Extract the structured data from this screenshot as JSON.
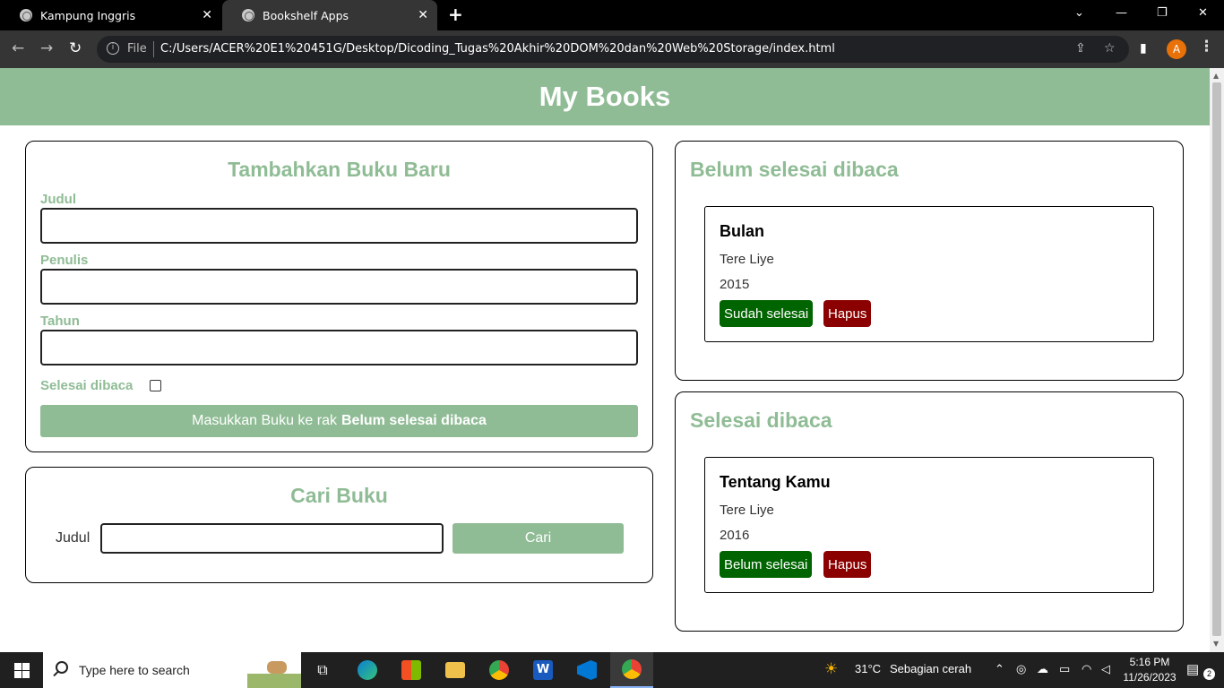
{
  "browser": {
    "tabs": [
      {
        "title": "Kampung Inggris",
        "active": false
      },
      {
        "title": "Bookshelf Apps",
        "active": true
      }
    ],
    "omnibox": {
      "scheme_label": "File",
      "url": "C:/Users/ACER%20E1%20451G/Desktop/Dicoding_Tugas%20Akhir%20DOM%20dan%20Web%20Storage/index.html"
    },
    "profile_initial": "A"
  },
  "page": {
    "header_title": "My Books",
    "add_form": {
      "title": "Tambahkan Buku Baru",
      "title_label": "Judul",
      "title_value": "",
      "author_label": "Penulis",
      "author_value": "",
      "year_label": "Tahun",
      "year_value": "",
      "complete_label": "Selesai dibaca",
      "complete_checked": false,
      "submit_prefix": "Masukkan Buku ke rak",
      "submit_target": "Belum selesai dibaca"
    },
    "search": {
      "title": "Cari Buku",
      "label": "Judul",
      "value": "",
      "button": "Cari"
    },
    "shelves": [
      {
        "title": "Belum selesai dibaca",
        "books": [
          {
            "title": "Bulan",
            "author": "Tere Liye",
            "year": "2015",
            "toggle_label": "Sudah selesai",
            "delete_label": "Hapus"
          }
        ]
      },
      {
        "title": "Selesai dibaca",
        "books": [
          {
            "title": "Tentang Kamu",
            "author": "Tere Liye",
            "year": "2016",
            "toggle_label": "Belum selesai",
            "delete_label": "Hapus"
          }
        ]
      }
    ]
  },
  "taskbar": {
    "search_placeholder": "Type here to search",
    "weather_temp": "31°C",
    "weather_text": "Sebagian cerah",
    "time": "5:16 PM",
    "date": "11/26/2023",
    "notification_count": "2"
  },
  "colors": {
    "accent": "#8fbc95",
    "done_button": "#006400",
    "delete_button": "#8b0000"
  }
}
